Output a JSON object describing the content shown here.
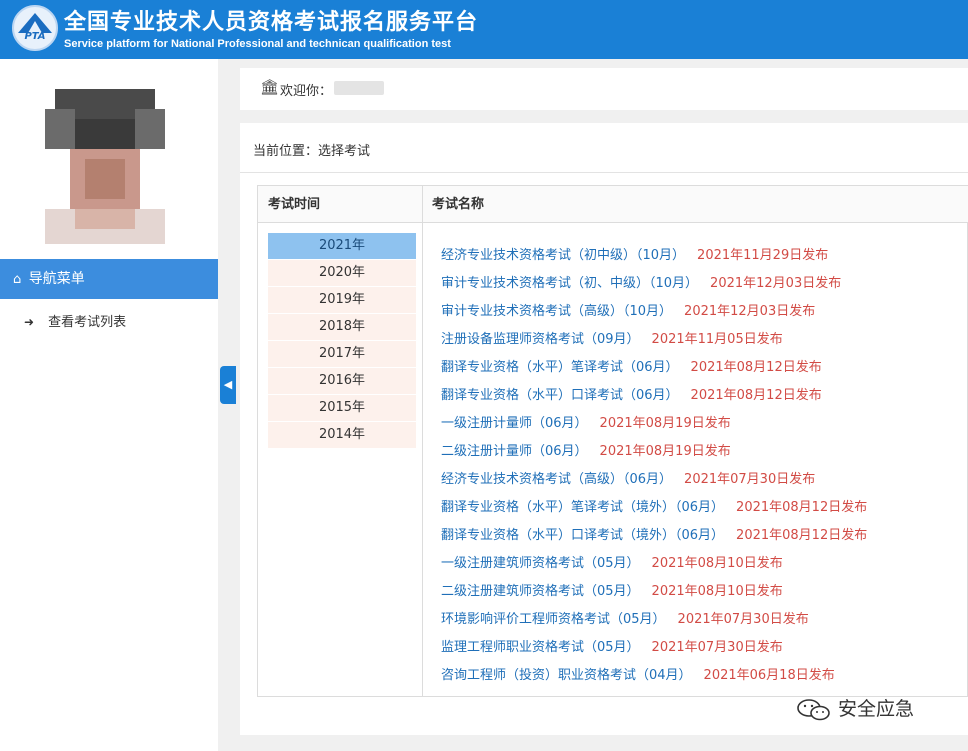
{
  "header": {
    "logo_text": "PTA",
    "title": "全国专业技术人员资格考试报名服务平台",
    "subtitle": "Service platform for National Professional and technican qualification test"
  },
  "sidebar": {
    "nav_header": "导航菜单",
    "nav_items": [
      {
        "label": "查看考试列表",
        "icon": "sign-in-icon"
      }
    ]
  },
  "welcome": {
    "label": "欢迎你：",
    "icon": "bank-icon"
  },
  "breadcrumb": "当前位置：选择考试",
  "years": {
    "header": "考试时间",
    "items": [
      "2021年",
      "2020年",
      "2019年",
      "2018年",
      "2017年",
      "2016年",
      "2015年",
      "2014年"
    ],
    "selected": "2021年"
  },
  "exams": {
    "header": "考试名称",
    "items": [
      {
        "name": "经济专业技术资格考试（初中级）（10月）",
        "date": "2021年11月29日发布"
      },
      {
        "name": "审计专业技术资格考试（初、中级）（10月）",
        "date": "2021年12月03日发布"
      },
      {
        "name": "审计专业技术资格考试（高级）（10月）",
        "date": "2021年12月03日发布"
      },
      {
        "name": "注册设备监理师资格考试（09月）",
        "date": "2021年11月05日发布"
      },
      {
        "name": "翻译专业资格（水平）笔译考试（06月）",
        "date": "2021年08月12日发布"
      },
      {
        "name": "翻译专业资格（水平）口译考试（06月）",
        "date": "2021年08月12日发布"
      },
      {
        "name": "一级注册计量师（06月）",
        "date": "2021年08月19日发布"
      },
      {
        "name": "二级注册计量师（06月）",
        "date": "2021年08月19日发布"
      },
      {
        "name": "经济专业技术资格考试（高级）（06月）",
        "date": "2021年07月30日发布"
      },
      {
        "name": "翻译专业资格（水平）笔译考试（境外）（06月）",
        "date": "2021年08月12日发布"
      },
      {
        "name": "翻译专业资格（水平）口译考试（境外）（06月）",
        "date": "2021年08月12日发布"
      },
      {
        "name": "一级注册建筑师资格考试（05月）",
        "date": "2021年08月10日发布"
      },
      {
        "name": "二级注册建筑师资格考试（05月）",
        "date": "2021年08月10日发布"
      },
      {
        "name": "环境影响评价工程师资格考试（05月）",
        "date": "2021年07月30日发布"
      },
      {
        "name": "监理工程师职业资格考试（05月）",
        "date": "2021年07月30日发布"
      },
      {
        "name": "咨询工程师（投资）职业资格考试（04月）",
        "date": "2021年06月18日发布"
      }
    ]
  },
  "watermark": {
    "text": "安全应急",
    "icon": "wechat-icon"
  },
  "colors": {
    "header_bg": "#1a80d6",
    "nav_active": "#3c8dde",
    "link": "#1f6fb8",
    "date": "#d24b45",
    "year_active": "#8ec2ef",
    "year_bg": "#fdf1ec"
  }
}
